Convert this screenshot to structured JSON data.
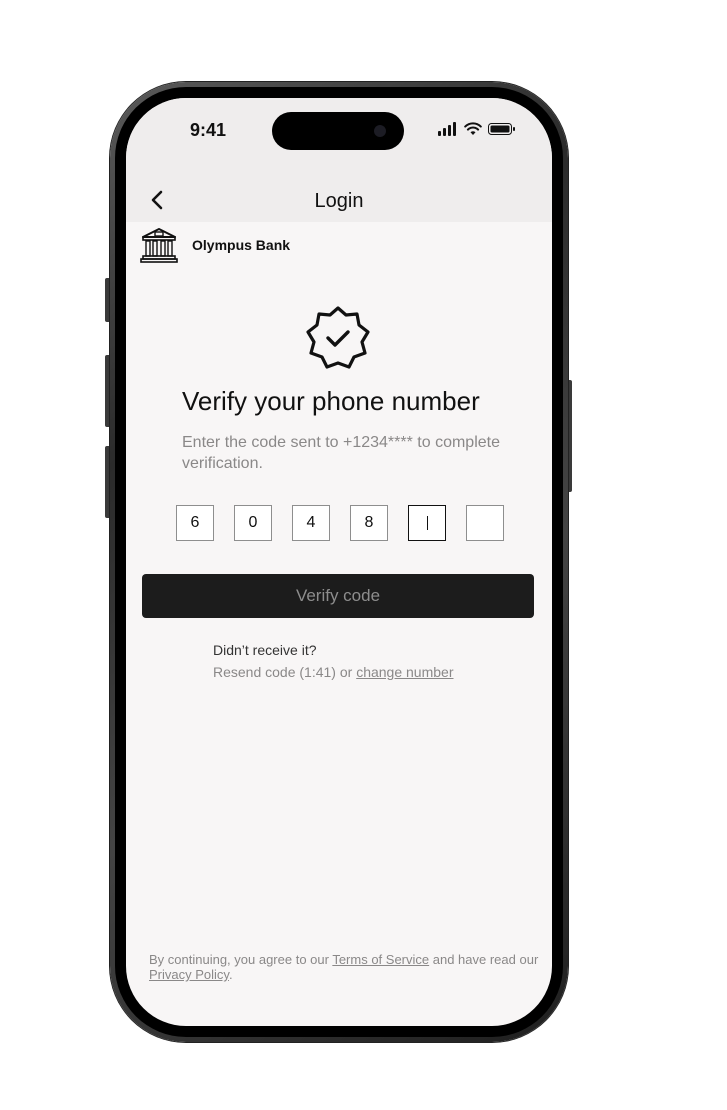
{
  "status_bar": {
    "time": "9:41"
  },
  "nav": {
    "title": "Login",
    "back_icon": "chevron-left-icon"
  },
  "brand": {
    "name": "Olympus Bank",
    "icon": "bank-building-icon"
  },
  "verify": {
    "icon": "verified-badge-icon",
    "heading": "Verify your phone number",
    "subtext": "Enter the code sent to +1234**** to complete verification.",
    "code_digits": [
      "6",
      "0",
      "4",
      "8",
      "",
      ""
    ],
    "active_index": 4,
    "button_label": "Verify code"
  },
  "resend": {
    "question": "Didn’t receive it?",
    "prefix": "Resend code (1:41) or ",
    "change_link": "change number"
  },
  "footer": {
    "prefix": "By continuing, you agree to our ",
    "terms_link": "Terms of Service",
    "middle": " and have read our ",
    "privacy_link": "Privacy Policy",
    "suffix": "."
  },
  "colors": {
    "screen_bg": "#f8f6f6",
    "header_bg": "#efeded",
    "button_bg": "#1c1c1c",
    "muted_text": "#8a8888"
  }
}
